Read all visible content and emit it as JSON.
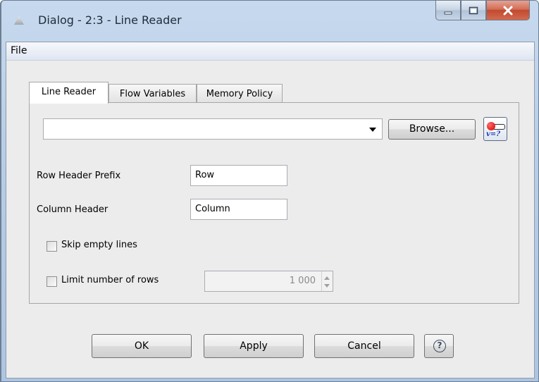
{
  "window": {
    "title": "Dialog - 2:3 - Line Reader"
  },
  "menu": {
    "file": "File"
  },
  "tabs": [
    {
      "label": "Line Reader",
      "active": true
    },
    {
      "label": "Flow Variables",
      "active": false
    },
    {
      "label": "Memory Policy",
      "active": false
    }
  ],
  "file_combo": {
    "value": "",
    "browse_label": "Browse...",
    "flow_var_icon_text": "v=?"
  },
  "row_header_prefix": {
    "label": "Row Header Prefix",
    "value": "Row"
  },
  "column_header": {
    "label": "Column Header",
    "value": "Column"
  },
  "skip_empty_lines": {
    "label": "Skip empty lines",
    "checked": false
  },
  "limit_rows": {
    "label": "Limit number of rows",
    "checked": false,
    "value": "1 000"
  },
  "buttons": {
    "ok": "OK",
    "apply": "Apply",
    "cancel": "Cancel",
    "help": "?"
  },
  "colors": {
    "title_bar": "#b8cde6",
    "close_button": "#c14a2f",
    "dialog_bg": "#ececec"
  },
  "icons": {
    "minimize": "minimize-icon",
    "maximize": "maximize-icon",
    "close": "close-icon",
    "help": "help-icon",
    "flow_variable": "flow-variable-icon",
    "dropdown": "chevron-down-icon"
  }
}
